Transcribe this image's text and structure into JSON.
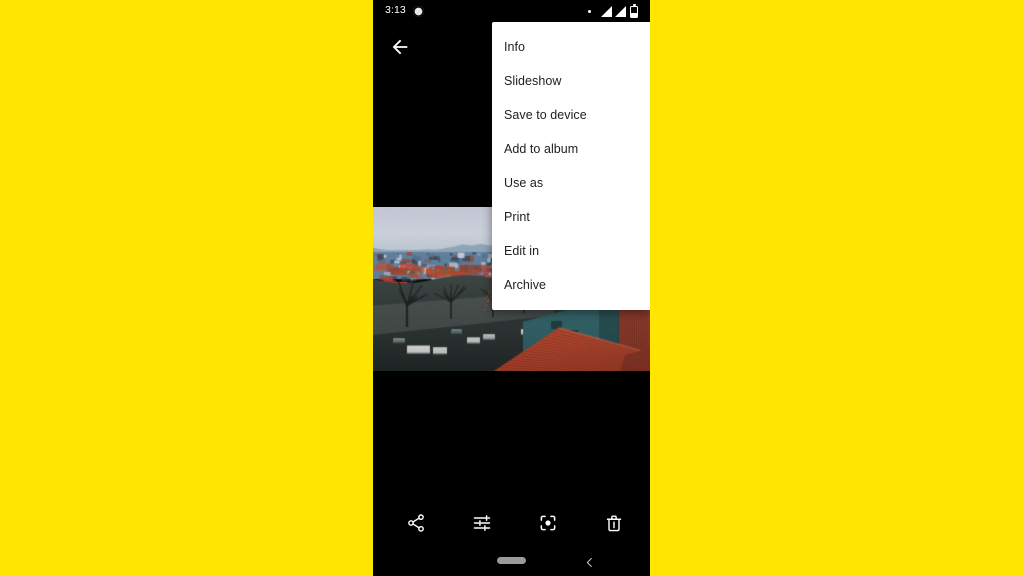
{
  "page": {
    "background_color": "#FFE600"
  },
  "phone": {
    "frame_color": "#000000",
    "status_bar": {
      "clock": "3:13",
      "notification_icon": "message-bubble-icon",
      "dot_icon": "small-dot-icon",
      "signal_icon_1": "signal-bars-icon",
      "signal_icon_2": "signal-bars-icon",
      "battery_icon": "battery-icon"
    },
    "app_bar": {
      "back_icon": "arrow-left-icon"
    },
    "photo": {
      "description": "Elevated view of a town with red tile roofs, bare trees, parked cars and a teal building under a hazy pale blue sky",
      "sky_color": "#c9cdd8",
      "distant_city_color": "#5d7f9e",
      "roof_color": "#c0432a",
      "teal_building_color": "#2e5f62",
      "foreground_color": "#2a2f2c"
    },
    "bottom_toolbar": {
      "items": [
        {
          "name": "share-icon",
          "label": "Share"
        },
        {
          "name": "tune-icon",
          "label": "Edit"
        },
        {
          "name": "lens-icon",
          "label": "Lens"
        },
        {
          "name": "trash-icon",
          "label": "Delete"
        }
      ]
    },
    "nav_bar": {
      "home_pill": "home-gesture-pill",
      "back_icon": "chevron-left-icon"
    }
  },
  "overflow_menu": {
    "background_color": "#ffffff",
    "text_color": "#202124",
    "items": [
      {
        "label": "Info"
      },
      {
        "label": "Slideshow"
      },
      {
        "label": "Save to device"
      },
      {
        "label": "Add to album"
      },
      {
        "label": "Use as"
      },
      {
        "label": "Print"
      },
      {
        "label": "Edit in"
      },
      {
        "label": "Archive"
      }
    ]
  }
}
